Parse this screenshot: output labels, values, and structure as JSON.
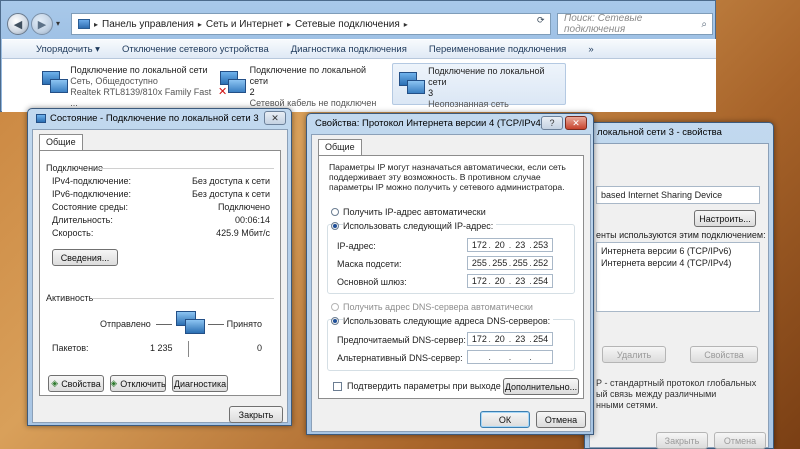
{
  "explorer": {
    "nav": {
      "back_icon": "back-arrow-icon",
      "forward_icon": "forward-arrow-icon"
    },
    "breadcrumb": [
      "Панель управления",
      "Сеть и Интернет",
      "Сетевые подключения"
    ],
    "search_placeholder": "Поиск: Сетевые подключения",
    "toolbar": {
      "organize": "Упорядочить",
      "disable": "Отключение сетевого устройства",
      "diagnose": "Диагностика подключения",
      "rename": "Переименование подключения",
      "more": "»"
    },
    "connections": [
      {
        "name": "Подключение по локальной сети",
        "line2": "Сеть, Общедоступно",
        "line3": "Realtek RTL8139/810x Family Fast ..."
      },
      {
        "name": "Подключение по локальной сети",
        "line2": "2",
        "line3": "Сетевой кабель не подключен"
      },
      {
        "name": "Подключение по локальной сети",
        "line2": "3",
        "line3": "Неопознанная сеть"
      }
    ]
  },
  "status_dialog": {
    "title": "Состояние - Подключение по локальной сети 3",
    "tab": "Общие",
    "section_connection": "Подключение",
    "rows": [
      {
        "label": "IPv4-подключение:",
        "value": "Без доступа к сети"
      },
      {
        "label": "IPv6-подключение:",
        "value": "Без доступа к сети"
      },
      {
        "label": "Состояние среды:",
        "value": "Подключено"
      },
      {
        "label": "Длительность:",
        "value": "00:06:14"
      },
      {
        "label": "Скорость:",
        "value": "425.9 Мбит/с"
      }
    ],
    "details_button": "Сведения...",
    "section_activity": "Активность",
    "sent_label": "Отправлено",
    "received_label": "Принято",
    "packets_label": "Пакетов:",
    "packets_sent": "1 235",
    "packets_received": "0",
    "btn_properties": "Свойства",
    "btn_disable": "Отключить",
    "btn_diagnose": "Диагностика",
    "btn_close": "Закрыть"
  },
  "ipv4_dialog": {
    "title": "Свойства: Протокол Интернета версии 4 (TCP/IPv4)",
    "help": "?",
    "tab": "Общие",
    "description": "Параметры IP могут назначаться автоматически, если сеть поддерживает эту возможность. В противном случае параметры IP можно получить у сетевого администратора.",
    "radio_auto_ip": "Получить IP-адрес автоматически",
    "radio_manual_ip": "Использовать следующий IP-адрес:",
    "ip_label": "IP-адрес:",
    "ip_value": [
      "172",
      "20",
      "23",
      "253"
    ],
    "mask_label": "Маска подсети:",
    "mask_value": [
      "255",
      "255",
      "255",
      "252"
    ],
    "gateway_label": "Основной шлюз:",
    "gateway_value": [
      "172",
      "20",
      "23",
      "254"
    ],
    "radio_auto_dns": "Получить адрес DNS-сервера автоматически",
    "radio_manual_dns": "Использовать следующие адреса DNS-серверов:",
    "dns1_label": "Предпочитаемый DNS-сервер:",
    "dns1_value": [
      "172",
      "20",
      "23",
      "254"
    ],
    "dns2_label": "Альтернативный DNS-сервер:",
    "dns2_value": [
      "",
      "",
      "",
      ""
    ],
    "validate_label": "Подтвердить параметры при выходе",
    "advanced_button": "Дополнительно...",
    "ok_button": "ОК",
    "cancel_button": "Отмена"
  },
  "props_dialog": {
    "title": "локальной сети 3 - свойства",
    "adapter": "based Internet Sharing Device",
    "configure_button": "Настроить...",
    "components_label": "енты используются этим подключением:",
    "components": [
      "Интернета версии 6 (TCP/IPv6)",
      "Интернета версии 4 (TCP/IPv4)"
    ],
    "remove_button": "Удалить",
    "properties_button": "Свойства",
    "desc_line1": "Р - стандартный протокол глобальных",
    "desc_line2": "ый связь между различными",
    "desc_line3": "нными сетями.",
    "close_button": "Закрыть",
    "cancel_button": "Отмена"
  }
}
